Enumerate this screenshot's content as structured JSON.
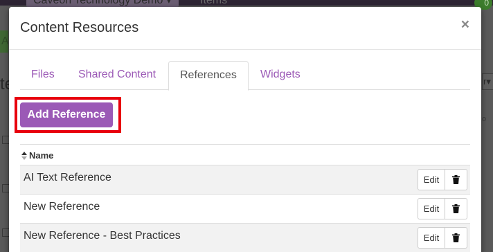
{
  "background": {
    "project_label": "Caveon Technology Demo",
    "items_label": "Items",
    "badge_value": "0"
  },
  "modal": {
    "title": "Content Resources",
    "close_glyph": "×"
  },
  "tabs": [
    {
      "label": "Files",
      "active": false
    },
    {
      "label": "Shared Content",
      "active": false
    },
    {
      "label": "References",
      "active": true
    },
    {
      "label": "Widgets",
      "active": false
    }
  ],
  "add_button_label": "Add Reference",
  "table": {
    "column_header": "Name",
    "rows": [
      {
        "name": "AI Text Reference",
        "edit_label": "Edit"
      },
      {
        "name": "New Reference",
        "edit_label": "Edit"
      },
      {
        "name": "New Reference - Best Practices",
        "edit_label": "Edit"
      }
    ]
  },
  "colors": {
    "accent": "#9b59b6",
    "highlight_border": "#e8000d",
    "active_tab_text": "#555555"
  },
  "icons": {
    "close": "close-icon",
    "sort": "sort-icon",
    "delete": "trash-icon"
  }
}
